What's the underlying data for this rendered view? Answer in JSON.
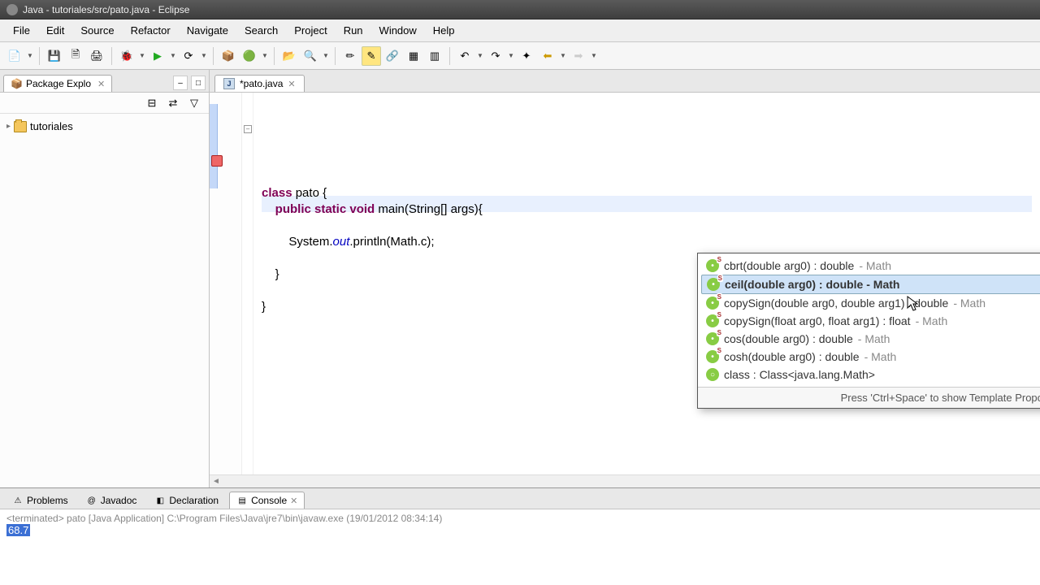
{
  "title": "Java - tutoriales/src/pato.java - Eclipse",
  "menu": [
    "File",
    "Edit",
    "Source",
    "Refactor",
    "Navigate",
    "Search",
    "Project",
    "Run",
    "Window",
    "Help"
  ],
  "sidebar": {
    "tab_label": "Package Explo",
    "root_project": "tutoriales"
  },
  "editor": {
    "tab_label": "*pato.java",
    "code_lines": [
      {
        "html": "<span class='kw'>class</span> <span class='cls'>pato</span> {"
      },
      {
        "html": "    <span class='kw'>public static void</span> main(String[] args){"
      },
      {
        "html": ""
      },
      {
        "html": "        System.<span class='st'>out</span>.println(Math.c);"
      },
      {
        "html": ""
      },
      {
        "html": "    }"
      },
      {
        "html": ""
      },
      {
        "html": "}"
      }
    ]
  },
  "autocomplete": {
    "items": [
      {
        "sig": "cbrt(double arg0) : double",
        "origin": "Math",
        "static": true
      },
      {
        "sig": "ceil(double arg0) : double",
        "origin": "Math",
        "static": true,
        "selected": true
      },
      {
        "sig": "copySign(double arg0, double arg1) : double",
        "origin": "Math",
        "static": true
      },
      {
        "sig": "copySign(float arg0, float arg1) : float",
        "origin": "Math",
        "static": true
      },
      {
        "sig": "cos(double arg0) : double",
        "origin": "Math",
        "static": true
      },
      {
        "sig": "cosh(double arg0) : double",
        "origin": "Math",
        "static": true
      },
      {
        "sig": "class : Class<java.lang.Math>",
        "origin": null,
        "static": false
      }
    ],
    "footer": "Press 'Ctrl+Space' to show Template Proposals"
  },
  "bottom_tabs": [
    {
      "label": "Problems",
      "icon": "⚠"
    },
    {
      "label": "Javadoc",
      "icon": "@"
    },
    {
      "label": "Declaration",
      "icon": "◧"
    },
    {
      "label": "Console",
      "icon": "▤",
      "active": true
    }
  ],
  "console": {
    "header": "<terminated> pato [Java Application] C:\\Program Files\\Java\\jre7\\bin\\javaw.exe (19/01/2012 08:34:14)",
    "output": "68.7"
  }
}
